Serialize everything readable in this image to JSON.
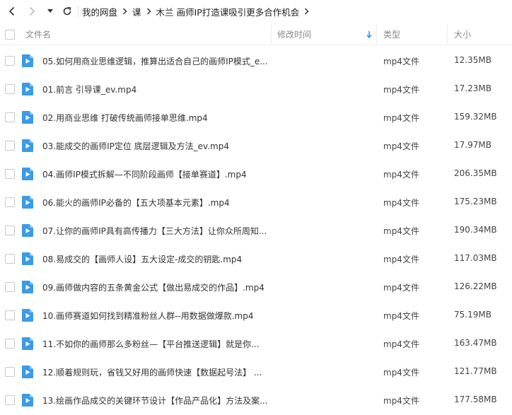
{
  "nav": {
    "breadcrumbs": [
      "我的网盘",
      "课",
      "木兰 画师IP打造课吸引更多合作机会"
    ]
  },
  "header": {
    "name": "文件名",
    "modified": "修改时间",
    "type": "类型",
    "size": "大小"
  },
  "colors": {
    "accent": "#2e8fe8",
    "icon_blue": "#3a9be8"
  },
  "files": [
    {
      "name": "05.如何用商业思维逻辑，推算出适合自己的画师IP模式_e...",
      "type": "mp4文件",
      "size": "12.35MB"
    },
    {
      "name": "01.前言 引导课_ev.mp4",
      "type": "mp4文件",
      "size": "17.23MB"
    },
    {
      "name": "02.用商业思维 打破传统画师接单思维.mp4",
      "type": "mp4文件",
      "size": "159.32MB"
    },
    {
      "name": "03.能成交的画师IP定位 底层逻辑及方法_ev.mp4",
      "type": "mp4文件",
      "size": "17.97MB"
    },
    {
      "name": "04.画师IP模式拆解—不同阶段画师【接单赛道】.mp4",
      "type": "mp4文件",
      "size": "206.35MB"
    },
    {
      "name": "06.能火的画师IP必备的【五大项基本元素】.mp4",
      "type": "mp4文件",
      "size": "175.23MB"
    },
    {
      "name": "07.让你的画师IP具有高传播力【三大方法】让你众所周知...",
      "type": "mp4文件",
      "size": "190.34MB"
    },
    {
      "name": "08.易成交的【画师人设】五大设定-成交的钥匙.mp4",
      "type": "mp4文件",
      "size": "117.03MB"
    },
    {
      "name": "09.画师做内容的五条黄金公式【做出易成交的作品】.mp4",
      "type": "mp4文件",
      "size": "126.22MB"
    },
    {
      "name": "10.画师赛道如何找到精准粉丝人群--用数据做爆款.mp4",
      "type": "mp4文件",
      "size": "75.19MB"
    },
    {
      "name": "11.不如你的画师那么多粉丝—【平台推送逻辑】就是你...",
      "type": "mp4文件",
      "size": "163.47MB"
    },
    {
      "name": "12.顺着规则玩，省钱又好用的画师快速【数据起号法】 ...",
      "type": "mp4文件",
      "size": "121.77MB"
    },
    {
      "name": "13.绘画作品成交的关键环节设计【作品产品化】方法及案...",
      "type": "mp4文件",
      "size": "177.58MB"
    }
  ]
}
